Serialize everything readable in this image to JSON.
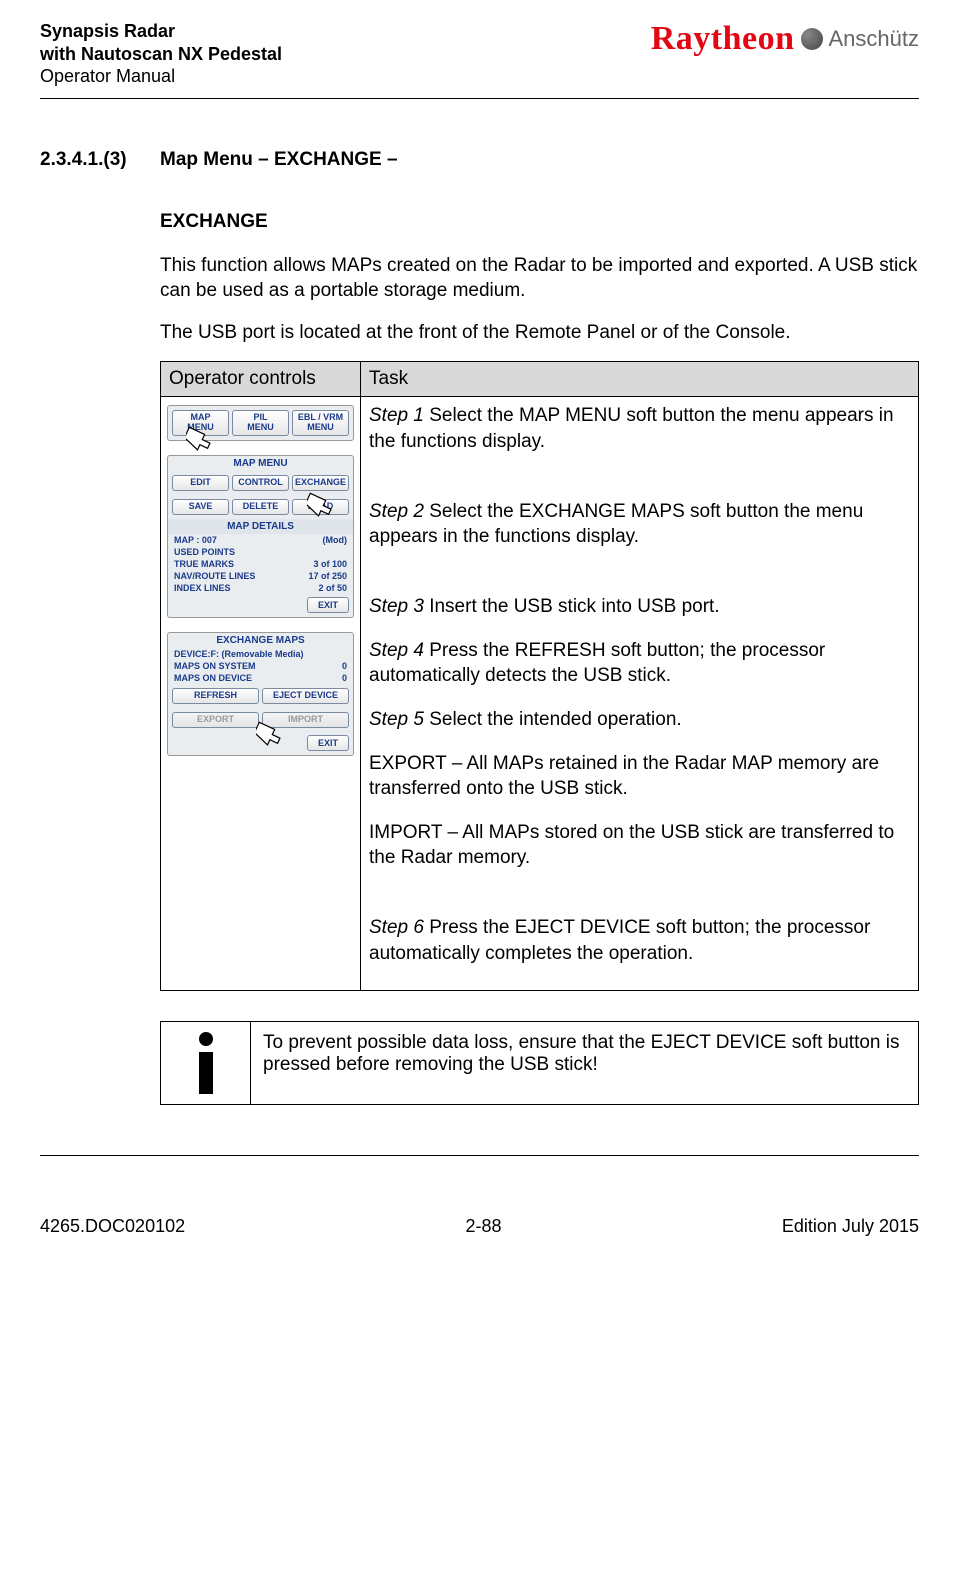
{
  "header": {
    "line1": "Synapsis Radar",
    "line2": "with Nautoscan NX Pedestal",
    "line3": "Operator Manual",
    "logo_brand": "Raytheon",
    "logo_sub": "Anschütz"
  },
  "section": {
    "number": "2.3.4.1.(3)",
    "title": "Map Menu – EXCHANGE –"
  },
  "exchange_heading": "EXCHANGE",
  "intro_p1": "This function allows MAPs created on the Radar to be imported and exported. A USB stick can be used as a portable storage medium.",
  "intro_p2": "The USB port is located at the front of the Remote Panel or of the Console.",
  "table": {
    "header_left": "Operator controls",
    "header_right": "Task",
    "panel1": {
      "btn1": "MAP\nMENU",
      "btn2": "PIL\nMENU",
      "btn3": "EBL / VRM\nMENU"
    },
    "panel2": {
      "title": "MAP MENU",
      "row1": [
        "EDIT",
        "CONTROL",
        "EXCHANGE"
      ],
      "row2": [
        "SAVE",
        "DELETE",
        "LOAD"
      ],
      "details_title": "MAP DETAILS",
      "lines": [
        [
          "MAP : 007",
          "(Mod)"
        ],
        [
          "USED POINTS",
          ""
        ],
        [
          "TRUE MARKS",
          "3  of   100"
        ],
        [
          "NAV/ROUTE LINES",
          "17  of   250"
        ],
        [
          "INDEX LINES",
          "2  of    50"
        ]
      ],
      "exit": "EXIT"
    },
    "panel3": {
      "title": "EXCHANGE MAPS",
      "lines": [
        [
          "DEVICE:F: (Removable Media)",
          ""
        ],
        [
          "MAPS ON SYSTEM",
          "0"
        ],
        [
          "MAPS ON DEVICE",
          "0"
        ]
      ],
      "row1": [
        "REFRESH",
        "EJECT DEVICE"
      ],
      "row2": [
        "EXPORT",
        "IMPORT"
      ],
      "exit": "EXIT"
    },
    "task": {
      "step1_label": "Step 1",
      "step1_text": " Select the MAP MENU soft button the menu appears in the functions display.",
      "step2_label": "Step 2",
      "step2_text": " Select the EXCHANGE MAPS soft button the menu appears in the functions display.",
      "step3_label": "Step 3",
      "step3_text": " Insert the USB stick into USB port.",
      "step4_label": "Step 4",
      "step4_text": " Press the REFRESH soft button; the processor automatically  detects the USB stick.",
      "step5_label": "Step 5",
      "step5_text": " Select the intended operation.",
      "export_text": "EXPORT – All MAPs retained in the Radar MAP memory are transferred onto the USB stick.",
      "import_text": "IMPORT – All MAPs stored on the USB stick are transferred to the Radar memory.",
      "step6_label": "Step 6",
      "step6_text": " Press the EJECT DEVICE soft button; the processor automatically completes the operation."
    }
  },
  "note": {
    "text": "To prevent possible data loss, ensure that the EJECT DEVICE soft button is pressed before removing the USB stick!"
  },
  "footer": {
    "left": "4265.DOC020102",
    "center": "2-88",
    "right": "Edition July 2015"
  }
}
